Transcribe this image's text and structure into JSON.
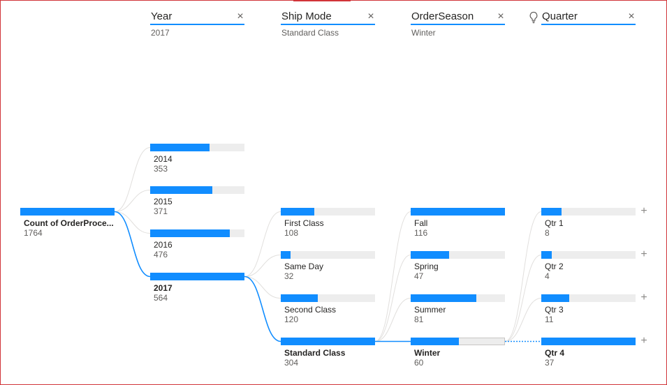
{
  "columns": [
    {
      "title": "Year",
      "subtitle": "2017",
      "has_bulb": false
    },
    {
      "title": "Ship Mode",
      "subtitle": "Standard Class",
      "has_bulb": false
    },
    {
      "title": "OrderSeason",
      "subtitle": "Winter",
      "has_bulb": false
    },
    {
      "title": "Quarter",
      "subtitle": "",
      "has_bulb": true
    }
  ],
  "close_glyph": "×",
  "expand_glyph": "+",
  "root": {
    "label": "Count of OrderProce...",
    "value": "1764",
    "fraction": 1.0
  },
  "levels": [
    [
      {
        "label": "2014",
        "value": "353",
        "fraction": 0.626,
        "selected": false
      },
      {
        "label": "2015",
        "value": "371",
        "fraction": 0.658,
        "selected": false
      },
      {
        "label": "2016",
        "value": "476",
        "fraction": 0.844,
        "selected": false
      },
      {
        "label": "2017",
        "value": "564",
        "fraction": 1.0,
        "selected": true
      }
    ],
    [
      {
        "label": "First Class",
        "value": "108",
        "fraction": 0.355,
        "selected": false
      },
      {
        "label": "Same Day",
        "value": "32",
        "fraction": 0.105,
        "selected": false
      },
      {
        "label": "Second Class",
        "value": "120",
        "fraction": 0.395,
        "selected": false
      },
      {
        "label": "Standard Class",
        "value": "304",
        "fraction": 1.0,
        "selected": true
      }
    ],
    [
      {
        "label": "Fall",
        "value": "116",
        "fraction": 1.0,
        "selected": false
      },
      {
        "label": "Spring",
        "value": "47",
        "fraction": 0.405,
        "selected": false
      },
      {
        "label": "Summer",
        "value": "81",
        "fraction": 0.698,
        "selected": false
      },
      {
        "label": "Winter",
        "value": "60",
        "fraction": 0.517,
        "selected": true
      }
    ],
    [
      {
        "label": "Qtr 1",
        "value": "8",
        "fraction": 0.216,
        "selected": false
      },
      {
        "label": "Qtr 2",
        "value": "4",
        "fraction": 0.108,
        "selected": false
      },
      {
        "label": "Qtr 3",
        "value": "11",
        "fraction": 0.297,
        "selected": false
      },
      {
        "label": "Qtr 4",
        "value": "37",
        "fraction": 1.0,
        "selected": true
      }
    ]
  ],
  "colors": {
    "bar_fill": "#118dff",
    "bar_track": "#ededed",
    "path_selected": "#118dff",
    "path_other": "#e1dfdd",
    "frame": "#d13438"
  }
}
